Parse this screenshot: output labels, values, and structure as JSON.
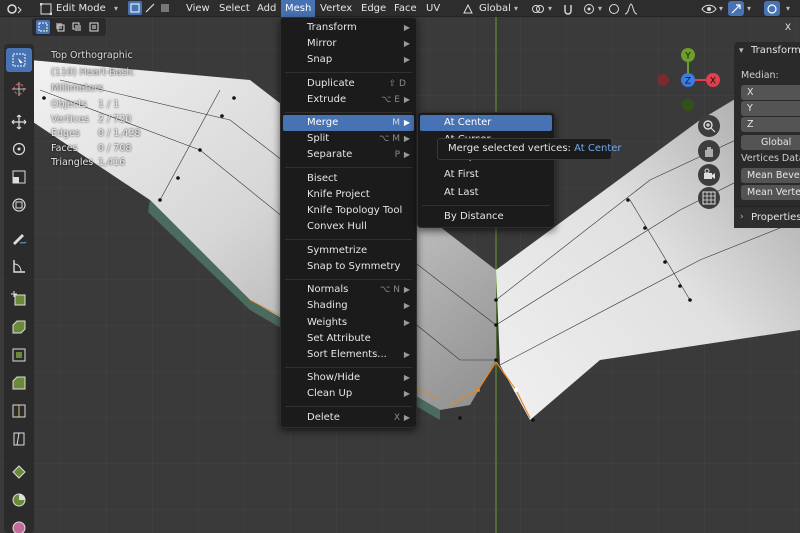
{
  "header": {
    "mode": "Edit Mode",
    "menus": [
      "View",
      "Select",
      "Add",
      "Mesh",
      "Vertex",
      "Edge",
      "Face",
      "UV"
    ],
    "active_menu": "Mesh",
    "transform_orientation": "Global"
  },
  "overlay": {
    "view_name": "Top Orthographic",
    "object_name": "(110) Heart-Basic",
    "units": "Millimeters",
    "stats": [
      {
        "label": "Objects",
        "value": "1 / 1"
      },
      {
        "label": "Vertices",
        "value": "2 / 720"
      },
      {
        "label": "Edges",
        "value": "0 / 1,428"
      },
      {
        "label": "Faces",
        "value": "0 / 708"
      },
      {
        "label": "Triangles",
        "value": "1,416"
      }
    ]
  },
  "mesh_menu": {
    "items": [
      {
        "label": "Transform",
        "shortcut": "",
        "submenu": true
      },
      {
        "label": "Mirror",
        "shortcut": "",
        "submenu": true
      },
      {
        "label": "Snap",
        "shortcut": "",
        "submenu": true
      },
      {
        "label": "Duplicate",
        "shortcut": "⇧ D",
        "submenu": false
      },
      {
        "label": "Extrude",
        "shortcut": "⌥ E",
        "submenu": true
      },
      {
        "label": "Merge",
        "shortcut": "M",
        "submenu": true
      },
      {
        "label": "Split",
        "shortcut": "⌥ M",
        "submenu": true
      },
      {
        "label": "Separate",
        "shortcut": "P",
        "submenu": true
      },
      {
        "label": "Bisect",
        "shortcut": "",
        "submenu": false
      },
      {
        "label": "Knife Project",
        "shortcut": "",
        "submenu": false
      },
      {
        "label": "Knife Topology Tool",
        "shortcut": "",
        "submenu": false
      },
      {
        "label": "Convex Hull",
        "shortcut": "",
        "submenu": false
      },
      {
        "label": "Symmetrize",
        "shortcut": "",
        "submenu": false
      },
      {
        "label": "Snap to Symmetry",
        "shortcut": "",
        "submenu": false
      },
      {
        "label": "Normals",
        "shortcut": "⌥ N",
        "submenu": true
      },
      {
        "label": "Shading",
        "shortcut": "",
        "submenu": true
      },
      {
        "label": "Weights",
        "shortcut": "",
        "submenu": true
      },
      {
        "label": "Set Attribute",
        "shortcut": "",
        "submenu": false
      },
      {
        "label": "Sort Elements...",
        "shortcut": "",
        "submenu": true
      },
      {
        "label": "Show/Hide",
        "shortcut": "",
        "submenu": true
      },
      {
        "label": "Clean Up",
        "shortcut": "",
        "submenu": true
      },
      {
        "label": "Delete",
        "shortcut": "X",
        "submenu": true
      }
    ]
  },
  "merge_menu": {
    "items": [
      "At Center",
      "At Cursor",
      "Collapse",
      "At First",
      "At Last",
      "By Distance"
    ]
  },
  "tooltip": {
    "text": "Merge selected vertices:",
    "accent": "At Center"
  },
  "npanel": {
    "tab_title": "Transform",
    "median_label": "Median:",
    "axes": [
      "X",
      "Y",
      "Z"
    ],
    "space": "Global",
    "vertex_data_label": "Vertices Data:",
    "mean_bevel": "Mean Bevel Weight",
    "mean_vertex": "Mean Vertex Crease",
    "properties_label": "Properties"
  },
  "gizmo": {
    "x": "X",
    "y": "Y",
    "z": "Z"
  },
  "colors": {
    "accent": "#4772b3",
    "x_axis": "#e0404e",
    "y_axis": "#6ca02a",
    "z_axis": "#3c7ce0"
  }
}
